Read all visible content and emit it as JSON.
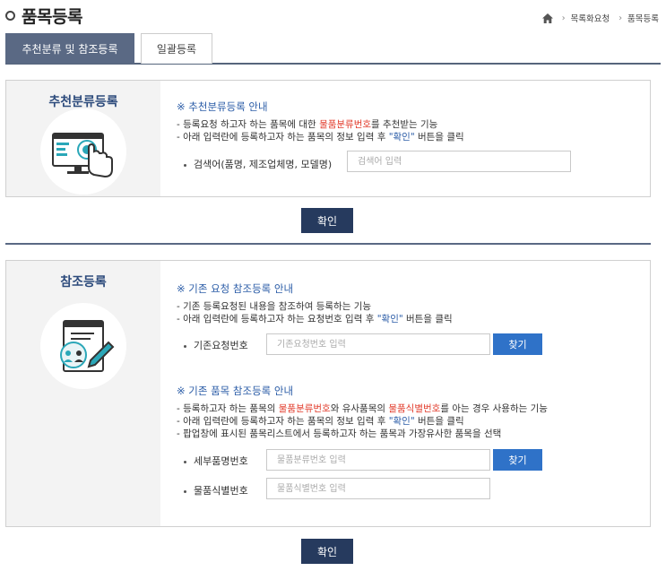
{
  "page": {
    "title": "품목등록"
  },
  "breadcrumb": {
    "home_icon": "home-icon",
    "items": [
      "목록화요청",
      "품목등록"
    ]
  },
  "tabs": [
    {
      "label": "추천분류 및 참조등록",
      "active": true
    },
    {
      "label": "일괄등록",
      "active": false
    }
  ],
  "recommend": {
    "left_title": "추천분류등록",
    "icon": "touch-monitor-icon",
    "notice_title": "※ 추천분류등록 안내",
    "desc1": {
      "pre": "- 등록요청 하고자 하는 품목에 대한 ",
      "highlight": "물품분류번호",
      "post": "를 추천받는 기능"
    },
    "desc2": {
      "pre": "- 아래 입력란에 등록하고자 하는 품목의 정보 입력 후 ",
      "highlight": "\"확인\"",
      "post": " 버튼을 클릭"
    },
    "search_label": "검색어(품명, 제조업체명, 모델명)",
    "search_placeholder": "검색어 입력",
    "confirm_label": "확인"
  },
  "reference": {
    "left_title": "참조등록",
    "icon": "document-pen-icon",
    "existing_request": {
      "notice_title": "※ 기존 요청 참조등록 안내",
      "desc1": "- 기존 등록요청된 내용을 참조하여 등록하는 기능",
      "desc2": {
        "pre": "- 아래 입력란에 등록하고자 하는 요청번호 입력 후 ",
        "highlight": "\"확인\"",
        "post": " 버튼을 클릭"
      },
      "field_label": "기존요청번호",
      "field_placeholder": "기존요청번호 입력",
      "find_label": "찾기"
    },
    "existing_item": {
      "notice_title": "※ 기존 품목 참조등록 안내",
      "desc1": {
        "pre": "- 등록하고자 하는 품목의 ",
        "highlight1": "물품분류번호",
        "mid": "와 유사품목의 ",
        "highlight2": "물품식별번호",
        "post": "를 아는 경우 사용하는 기능"
      },
      "desc2": {
        "pre": "- 아래 입력란에 등록하고자 하는 품목의 정보 입력 후 ",
        "highlight": "\"확인\"",
        "post": " 버튼을 클릭"
      },
      "desc3": "- 팝업창에 표시된 품목리스트에서 등록하고자 하는 품목과 가장유사한 품목을 선택",
      "field1_label": "세부품명번호",
      "field1_placeholder": "물품분류번호 입력",
      "find_label": "찾기",
      "field2_label": "물품식별번호",
      "field2_placeholder": "물품식별번호 입력"
    },
    "confirm_label": "확인"
  },
  "colors": {
    "accent_red": "#e23c2c",
    "accent_blue": "#2d5ea8",
    "tab_active": "#5a6984",
    "button_dark": "#263a5e",
    "button_blue": "#2f72c8"
  }
}
